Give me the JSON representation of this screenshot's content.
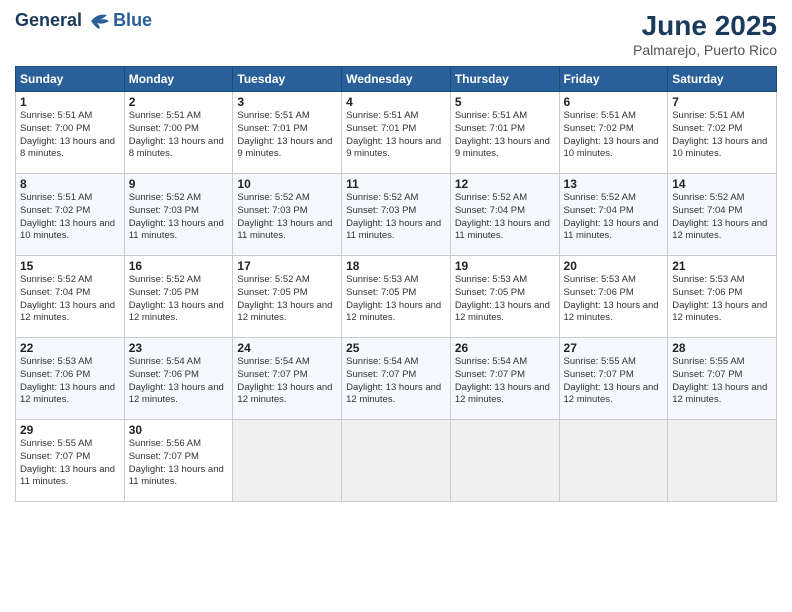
{
  "header": {
    "logo_line1": "General",
    "logo_line2": "Blue",
    "title": "June 2025",
    "subtitle": "Palmarejo, Puerto Rico"
  },
  "weekdays": [
    "Sunday",
    "Monday",
    "Tuesday",
    "Wednesday",
    "Thursday",
    "Friday",
    "Saturday"
  ],
  "weeks": [
    [
      {
        "day": "1",
        "sunrise": "5:51 AM",
        "sunset": "7:00 PM",
        "daylight": "13 hours and 8 minutes."
      },
      {
        "day": "2",
        "sunrise": "5:51 AM",
        "sunset": "7:00 PM",
        "daylight": "13 hours and 8 minutes."
      },
      {
        "day": "3",
        "sunrise": "5:51 AM",
        "sunset": "7:01 PM",
        "daylight": "13 hours and 9 minutes."
      },
      {
        "day": "4",
        "sunrise": "5:51 AM",
        "sunset": "7:01 PM",
        "daylight": "13 hours and 9 minutes."
      },
      {
        "day": "5",
        "sunrise": "5:51 AM",
        "sunset": "7:01 PM",
        "daylight": "13 hours and 9 minutes."
      },
      {
        "day": "6",
        "sunrise": "5:51 AM",
        "sunset": "7:02 PM",
        "daylight": "13 hours and 10 minutes."
      },
      {
        "day": "7",
        "sunrise": "5:51 AM",
        "sunset": "7:02 PM",
        "daylight": "13 hours and 10 minutes."
      }
    ],
    [
      {
        "day": "8",
        "sunrise": "5:51 AM",
        "sunset": "7:02 PM",
        "daylight": "13 hours and 10 minutes."
      },
      {
        "day": "9",
        "sunrise": "5:52 AM",
        "sunset": "7:03 PM",
        "daylight": "13 hours and 11 minutes."
      },
      {
        "day": "10",
        "sunrise": "5:52 AM",
        "sunset": "7:03 PM",
        "daylight": "13 hours and 11 minutes."
      },
      {
        "day": "11",
        "sunrise": "5:52 AM",
        "sunset": "7:03 PM",
        "daylight": "13 hours and 11 minutes."
      },
      {
        "day": "12",
        "sunrise": "5:52 AM",
        "sunset": "7:04 PM",
        "daylight": "13 hours and 11 minutes."
      },
      {
        "day": "13",
        "sunrise": "5:52 AM",
        "sunset": "7:04 PM",
        "daylight": "13 hours and 11 minutes."
      },
      {
        "day": "14",
        "sunrise": "5:52 AM",
        "sunset": "7:04 PM",
        "daylight": "13 hours and 12 minutes."
      }
    ],
    [
      {
        "day": "15",
        "sunrise": "5:52 AM",
        "sunset": "7:04 PM",
        "daylight": "13 hours and 12 minutes."
      },
      {
        "day": "16",
        "sunrise": "5:52 AM",
        "sunset": "7:05 PM",
        "daylight": "13 hours and 12 minutes."
      },
      {
        "day": "17",
        "sunrise": "5:52 AM",
        "sunset": "7:05 PM",
        "daylight": "13 hours and 12 minutes."
      },
      {
        "day": "18",
        "sunrise": "5:53 AM",
        "sunset": "7:05 PM",
        "daylight": "13 hours and 12 minutes."
      },
      {
        "day": "19",
        "sunrise": "5:53 AM",
        "sunset": "7:05 PM",
        "daylight": "13 hours and 12 minutes."
      },
      {
        "day": "20",
        "sunrise": "5:53 AM",
        "sunset": "7:06 PM",
        "daylight": "13 hours and 12 minutes."
      },
      {
        "day": "21",
        "sunrise": "5:53 AM",
        "sunset": "7:06 PM",
        "daylight": "13 hours and 12 minutes."
      }
    ],
    [
      {
        "day": "22",
        "sunrise": "5:53 AM",
        "sunset": "7:06 PM",
        "daylight": "13 hours and 12 minutes."
      },
      {
        "day": "23",
        "sunrise": "5:54 AM",
        "sunset": "7:06 PM",
        "daylight": "13 hours and 12 minutes."
      },
      {
        "day": "24",
        "sunrise": "5:54 AM",
        "sunset": "7:07 PM",
        "daylight": "13 hours and 12 minutes."
      },
      {
        "day": "25",
        "sunrise": "5:54 AM",
        "sunset": "7:07 PM",
        "daylight": "13 hours and 12 minutes."
      },
      {
        "day": "26",
        "sunrise": "5:54 AM",
        "sunset": "7:07 PM",
        "daylight": "13 hours and 12 minutes."
      },
      {
        "day": "27",
        "sunrise": "5:55 AM",
        "sunset": "7:07 PM",
        "daylight": "13 hours and 12 minutes."
      },
      {
        "day": "28",
        "sunrise": "5:55 AM",
        "sunset": "7:07 PM",
        "daylight": "13 hours and 12 minutes."
      }
    ],
    [
      {
        "day": "29",
        "sunrise": "5:55 AM",
        "sunset": "7:07 PM",
        "daylight": "13 hours and 11 minutes."
      },
      {
        "day": "30",
        "sunrise": "5:56 AM",
        "sunset": "7:07 PM",
        "daylight": "13 hours and 11 minutes."
      },
      null,
      null,
      null,
      null,
      null
    ]
  ],
  "labels": {
    "sunrise": "Sunrise:",
    "sunset": "Sunset:",
    "daylight": "Daylight:"
  }
}
